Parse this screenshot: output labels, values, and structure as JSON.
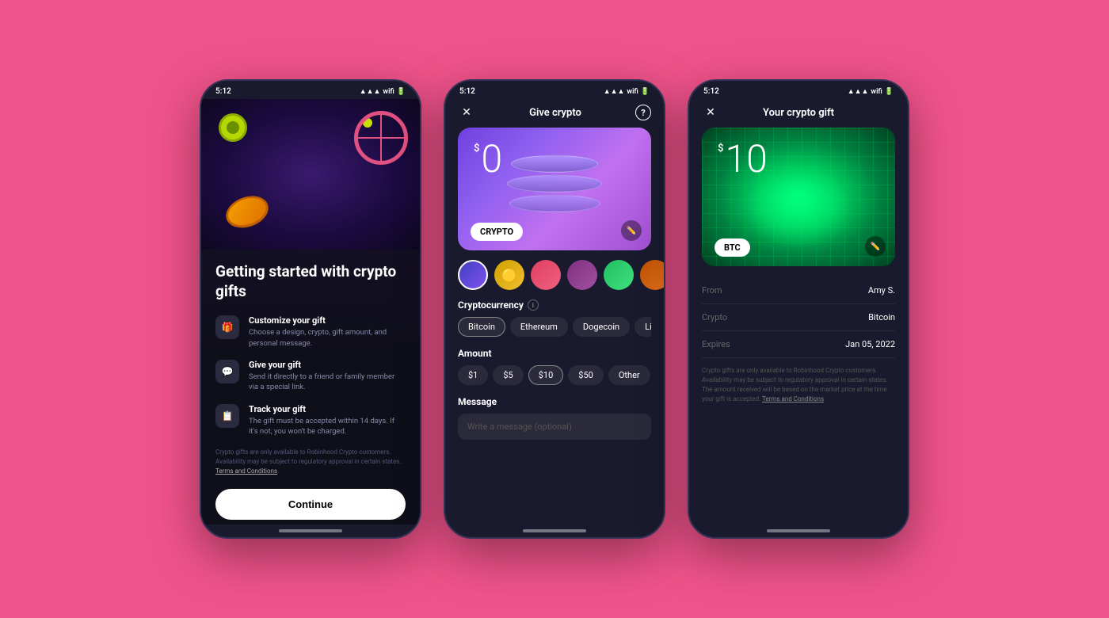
{
  "background_color": "#F0538A",
  "screen1": {
    "status_time": "5:12",
    "title": "Getting started with crypto gifts",
    "features": [
      {
        "id": "customize",
        "icon": "🎁",
        "title": "Customize your gift",
        "desc": "Choose a design, crypto, gift amount, and personal message."
      },
      {
        "id": "give",
        "icon": "💬",
        "title": "Give your gift",
        "desc": "Send it directly to a friend or family member via a special link."
      },
      {
        "id": "track",
        "icon": "📋",
        "title": "Track your gift",
        "desc": "The gift must be accepted within 14 days. If it's not, you won't be charged."
      }
    ],
    "disclaimer": "Crypto gifts are only available to Robinhood Crypto customers. Availability may be subject to regulatory approval in certain states.",
    "disclaimer_link": "Terms and Conditions",
    "continue_label": "Continue"
  },
  "screen2": {
    "status_time": "5:12",
    "header_title": "Give crypto",
    "close_icon": "✕",
    "help_icon": "?",
    "amount_symbol": "$",
    "amount_value": "0",
    "crypto_label": "CRYPTO",
    "designs": [
      {
        "color": "#5048e0",
        "selected": true
      },
      {
        "color": "#d4a020"
      },
      {
        "color": "#e04060"
      },
      {
        "color": "#8040a0"
      },
      {
        "color": "#30a050"
      },
      {
        "color": "#c07020"
      }
    ],
    "cryptocurrency_label": "Cryptocurrency",
    "crypto_options": [
      "Bitcoin",
      "Ethereum",
      "Dogecoin",
      "Litec"
    ],
    "selected_crypto": "Bitcoin",
    "amount_label": "Amount",
    "amount_options": [
      "$1",
      "$5",
      "$10",
      "$50",
      "Other"
    ],
    "selected_amount": "$10",
    "message_label": "Message",
    "message_placeholder": "Write a message (optional)"
  },
  "screen3": {
    "status_time": "5:12",
    "header_title": "Your crypto gift",
    "close_icon": "✕",
    "amount_symbol": "$",
    "amount_value": "10",
    "crypto_label": "BTC",
    "details": [
      {
        "label": "From",
        "value": "Amy S."
      },
      {
        "label": "Crypto",
        "value": "Bitcoin"
      },
      {
        "label": "Expires",
        "value": "Jan 05, 2022"
      }
    ],
    "disclaimer": "Crypto gifts are only available to Robinhood Crypto customers. Availability may be subject to regulatory approval in certain states. The amount received will be based on the market price at the time your gift is accepted.",
    "disclaimer_link": "Terms and Conditions"
  }
}
